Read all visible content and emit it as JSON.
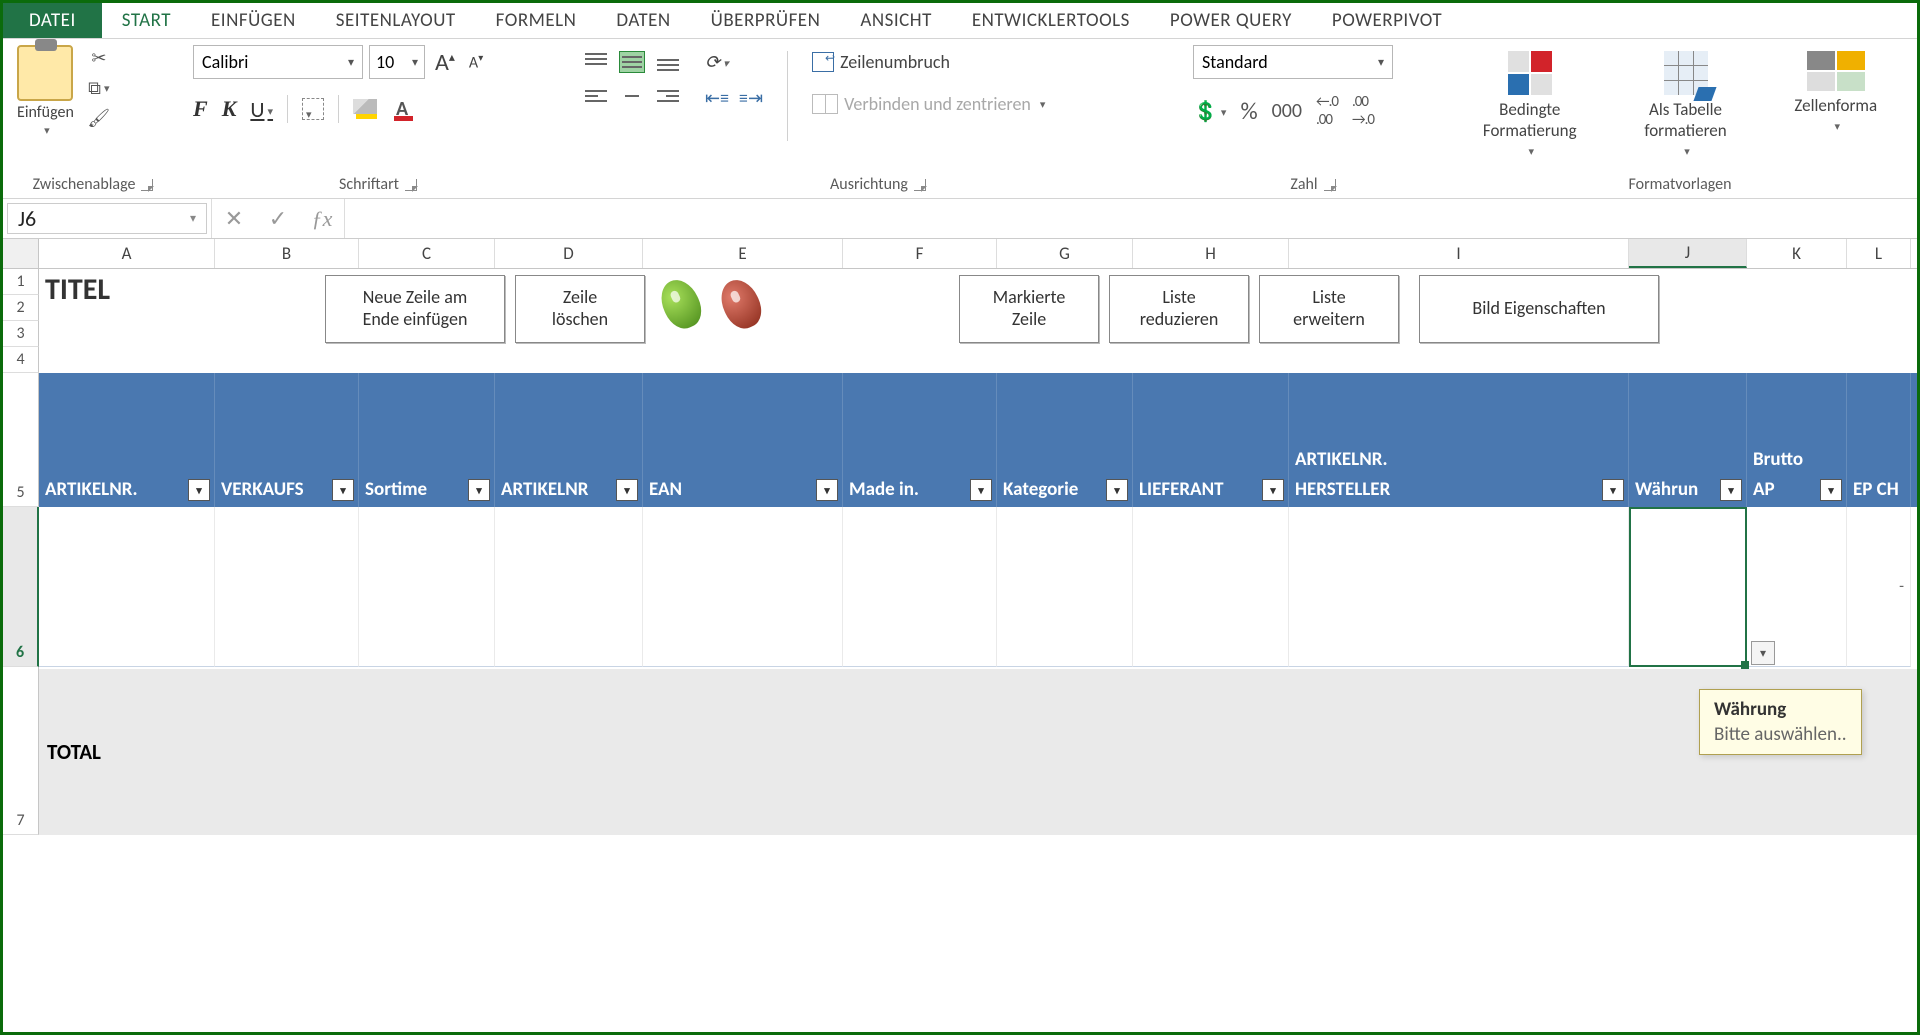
{
  "tabs": {
    "file": "DATEI",
    "start": "START",
    "einfuegen": "EINFÜGEN",
    "seitenlayout": "SEITENLAYOUT",
    "formeln": "FORMELN",
    "daten": "DATEN",
    "ueberpruefen": "ÜBERPRÜFEN",
    "ansicht": "ANSICHT",
    "entwicklertools": "ENTWICKLERTOOLS",
    "powerquery": "POWER QUERY",
    "powerpivot": "POWERPIVOT"
  },
  "ribbon": {
    "clipboard": {
      "paste": "Einfügen",
      "group": "Zwischenablage"
    },
    "font": {
      "name": "Calibri",
      "size": "10",
      "group": "Schriftart",
      "bold": "F",
      "italic": "K",
      "underline": "U",
      "color_letter": "A"
    },
    "align": {
      "wrap": "Zeilenumbruch",
      "merge": "Verbinden und zentrieren",
      "group": "Ausrichtung"
    },
    "number": {
      "format": "Standard",
      "group": "Zahl",
      "percent": "%",
      "thousand": "000",
      "dec_inc": ".0\n.00",
      "dec_dec": ".00\n.0"
    },
    "styles": {
      "cond": "Bedingte\nFormatierung",
      "table": "Als Tabelle\nformatieren",
      "cell": "Zellenforma",
      "group": "Formatvorlagen"
    }
  },
  "formula_bar": {
    "ref": "J6",
    "fx": "ƒx"
  },
  "columns": [
    "A",
    "B",
    "C",
    "D",
    "E",
    "F",
    "G",
    "H",
    "I",
    "J",
    "K",
    "L"
  ],
  "rows": [
    "1",
    "2",
    "3",
    "4",
    "5",
    "6",
    "7"
  ],
  "sheet": {
    "titel": "TITEL",
    "btn_neue": "Neue Zeile am\nEnde einfügen",
    "btn_loeschen": "Zeile\nlöschen",
    "btn_mark": "Markierte\nZeile",
    "btn_red": "Liste\nreduzieren",
    "btn_erw": "Liste\nerweitern",
    "btn_bild": "Bild Eigenschaften",
    "headers": {
      "artikelnr": "ARTIKELNR.",
      "verkaufs": "VERKAUFS",
      "sortime": "Sortime",
      "artikelnr2": "ARTIKELNR",
      "ean": "EAN",
      "madein": "Made in.",
      "kategorie": "Kategorie",
      "lieferant": "LIEFERANT",
      "artikelnr_h_top": "ARTIKELNR.",
      "artikelnr_h": "HERSTELLER",
      "waehrung": "Währun",
      "brutto_top": "Brutto",
      "ap": "AP",
      "epch": "EP CH"
    },
    "total": "TOTAL",
    "dash": "-"
  },
  "tooltip": {
    "title": "Währung",
    "body": "Bitte auswählen.."
  }
}
